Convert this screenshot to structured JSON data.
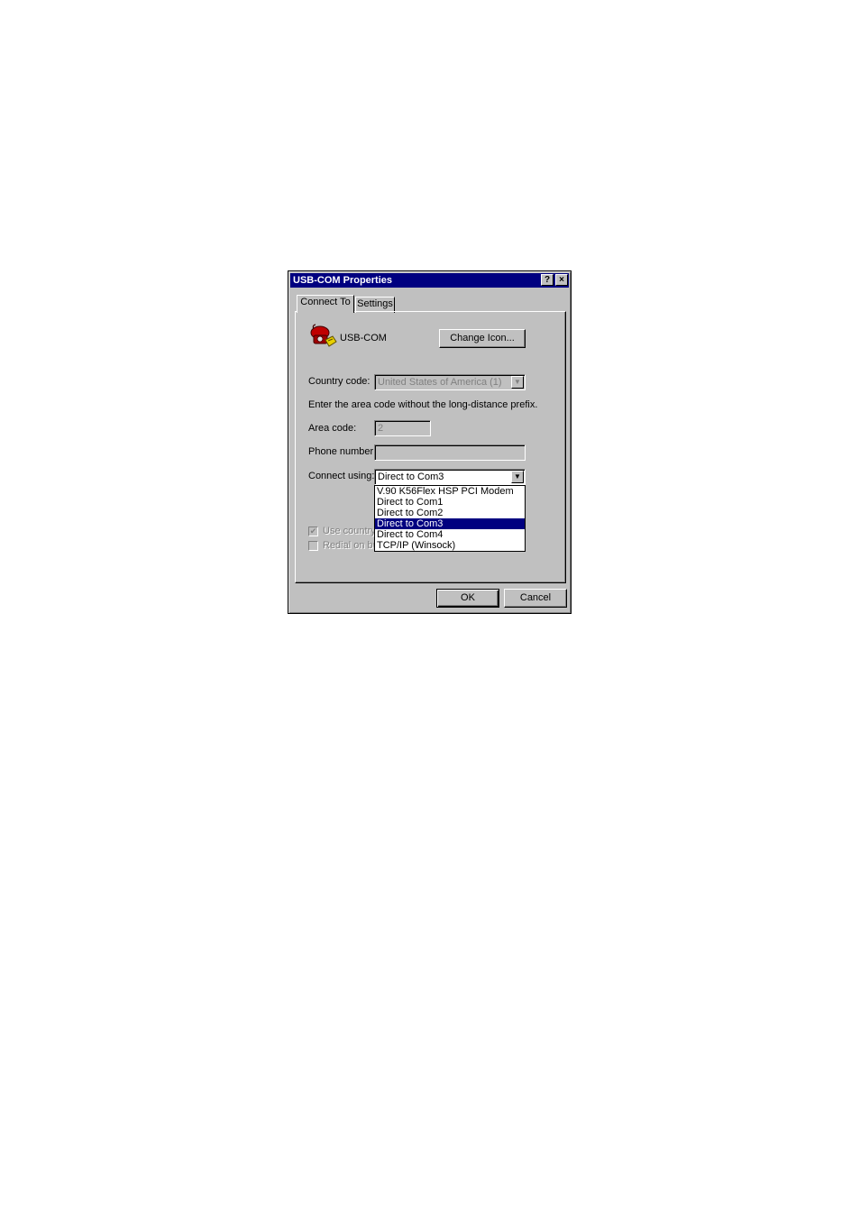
{
  "window": {
    "title": "USB-COM Properties",
    "help_glyph": "?",
    "close_glyph": "×"
  },
  "tabs": [
    {
      "label": "Connect To",
      "active": true
    },
    {
      "label": "Settings",
      "active": false
    }
  ],
  "connection": {
    "name": "USB-COM",
    "icon": "telephone-icon",
    "change_icon_label": "Change Icon..."
  },
  "country": {
    "label": "Country code:",
    "value": "United States of America (1)"
  },
  "area_hint": "Enter the area code without the long-distance prefix.",
  "area": {
    "label": "Area code:",
    "value": "2"
  },
  "phone": {
    "label": "Phone number:",
    "value": ""
  },
  "connect_using": {
    "label": "Connect using:",
    "value": "Direct to Com3",
    "options": [
      "V.90 K56Flex HSP PCI Modem",
      "Direct to Com1",
      "Direct to Com2",
      "Direct to Com3",
      "Direct to Com4",
      "TCP/IP (Winsock)"
    ],
    "selected_index": 3
  },
  "checkboxes": [
    {
      "label": "Use country",
      "checked": true,
      "enabled": false
    },
    {
      "label": "Redial on bu",
      "checked": false,
      "enabled": false
    }
  ],
  "buttons": {
    "ok": "OK",
    "cancel": "Cancel"
  }
}
